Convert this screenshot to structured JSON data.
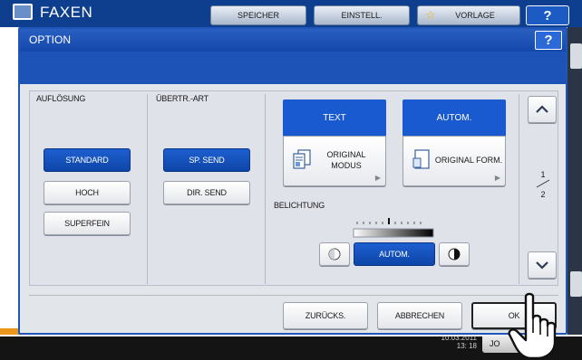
{
  "background": {
    "app_title": "FAXEN",
    "tabs": [
      "SPEICHER",
      "EINSTELL.",
      "VORLAGE"
    ],
    "help": "?",
    "clock": [
      "10.03.2011",
      "13: 18"
    ],
    "job_label": "JO"
  },
  "dialog": {
    "title": "OPTION",
    "help": "?",
    "resolution": {
      "label": "AUFLÖSUNG",
      "options": [
        "STANDARD",
        "HOCH",
        "SUPERFEIN"
      ],
      "selected": "STANDARD"
    },
    "transfer": {
      "label": "ÜBERTR.-ART",
      "options": [
        "SP. SEND",
        "DIR. SEND"
      ],
      "selected": "SP. SEND"
    },
    "original_mode": {
      "current": "TEXT",
      "button_line1": "ORIGINAL",
      "button_line2": "MODUS"
    },
    "original_format": {
      "current": "AUTOM.",
      "button": "ORIGINAL FORM."
    },
    "exposure": {
      "label": "BELICHTUNG",
      "value": "AUTOM."
    },
    "pager": {
      "current": "1",
      "total": "2"
    },
    "actions": {
      "reset": "ZURÜCKS.",
      "cancel": "ABBRECHEN",
      "ok": "OK"
    }
  },
  "colors": {
    "accent_blue": "#1a5ad0",
    "title_blue": "#1449ab",
    "panel": "#dfe2e8"
  }
}
